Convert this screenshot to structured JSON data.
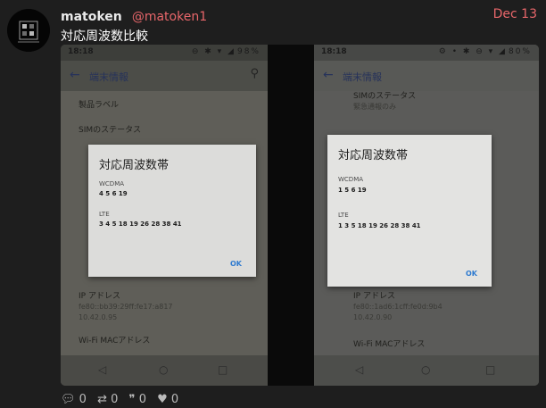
{
  "post": {
    "display_name": "matoken",
    "handle": "@matoken1",
    "date": "Dec 13",
    "text": "対応周波数比較"
  },
  "actions": {
    "replies": "0",
    "reblogs": "0",
    "quotes": "0",
    "likes": "0"
  },
  "phones": {
    "left": {
      "time": "18:18",
      "battery": "98%",
      "app_title": "端末情報",
      "items": [
        {
          "title": "製品ラベル",
          "sub": ""
        },
        {
          "title": "SIMのステータス",
          "sub": ""
        },
        {
          "title": "IP アドレス",
          "sub": "fe80::bb39:29ff:fe17:a817"
        },
        {
          "title": "",
          "sub": "10.42.0.95"
        },
        {
          "title": "Wi-Fi MACアドレス",
          "sub": ""
        }
      ],
      "dialog": {
        "title": "対応周波数帯",
        "wcdma_label": "WCDMA",
        "wcdma_value": "4 5 6 19",
        "lte_label": "LTE",
        "lte_value": "3 4 5 18 19 26 28 38 41",
        "ok": "OK"
      }
    },
    "right": {
      "time": "18:18",
      "battery": "80%",
      "app_title": "端末情報",
      "items": [
        {
          "title": "SIMのステータス",
          "sub": "緊急通報のみ"
        },
        {
          "title": "IP アドレス",
          "sub": "fe80::1ad6:1cff:fe0d:9b4"
        },
        {
          "title": "",
          "sub": "10.42.0.90"
        },
        {
          "title": "Wi-Fi MACアドレス",
          "sub": ""
        }
      ],
      "dialog": {
        "title": "対応周波数帯",
        "wcdma_label": "WCDMA",
        "wcdma_value": "1 5 6 19",
        "lte_label": "LTE",
        "lte_value": "1 3 5 18 19 26 28 38 41",
        "ok": "OK"
      }
    }
  },
  "icons": {
    "reply": "speech-bubble",
    "reblog": "retweet-arrows",
    "quote": "quote-marks",
    "like": "heart"
  },
  "colors": {
    "accent": "#e8666a",
    "background": "#1e1e1e"
  }
}
